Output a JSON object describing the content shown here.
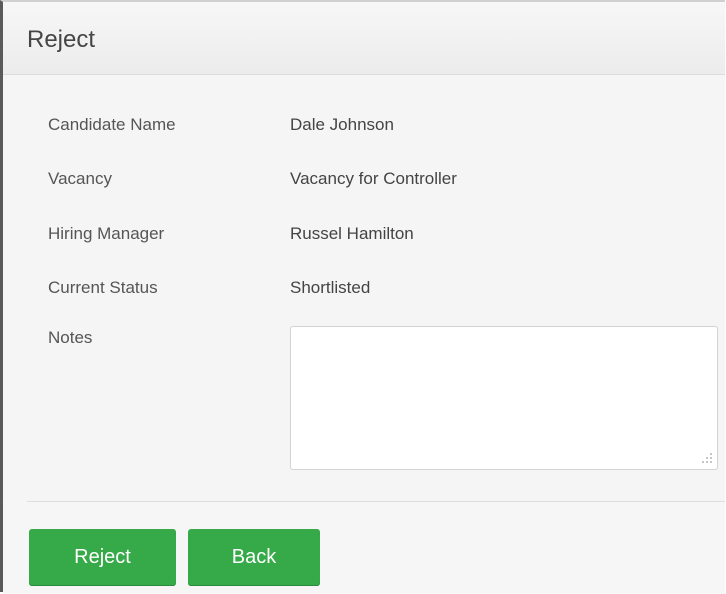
{
  "dialog": {
    "title": "Reject"
  },
  "fields": {
    "candidate_name_label": "Candidate Name",
    "candidate_name_value": "Dale Johnson",
    "vacancy_label": "Vacancy",
    "vacancy_value": "Vacancy for Controller",
    "hiring_manager_label": "Hiring Manager",
    "hiring_manager_value": "Russel Hamilton",
    "current_status_label": "Current Status",
    "current_status_value": "Shortlisted",
    "notes_label": "Notes",
    "notes_value": ""
  },
  "actions": {
    "reject_label": "Reject",
    "back_label": "Back"
  },
  "colors": {
    "button_green": "#36a948"
  }
}
